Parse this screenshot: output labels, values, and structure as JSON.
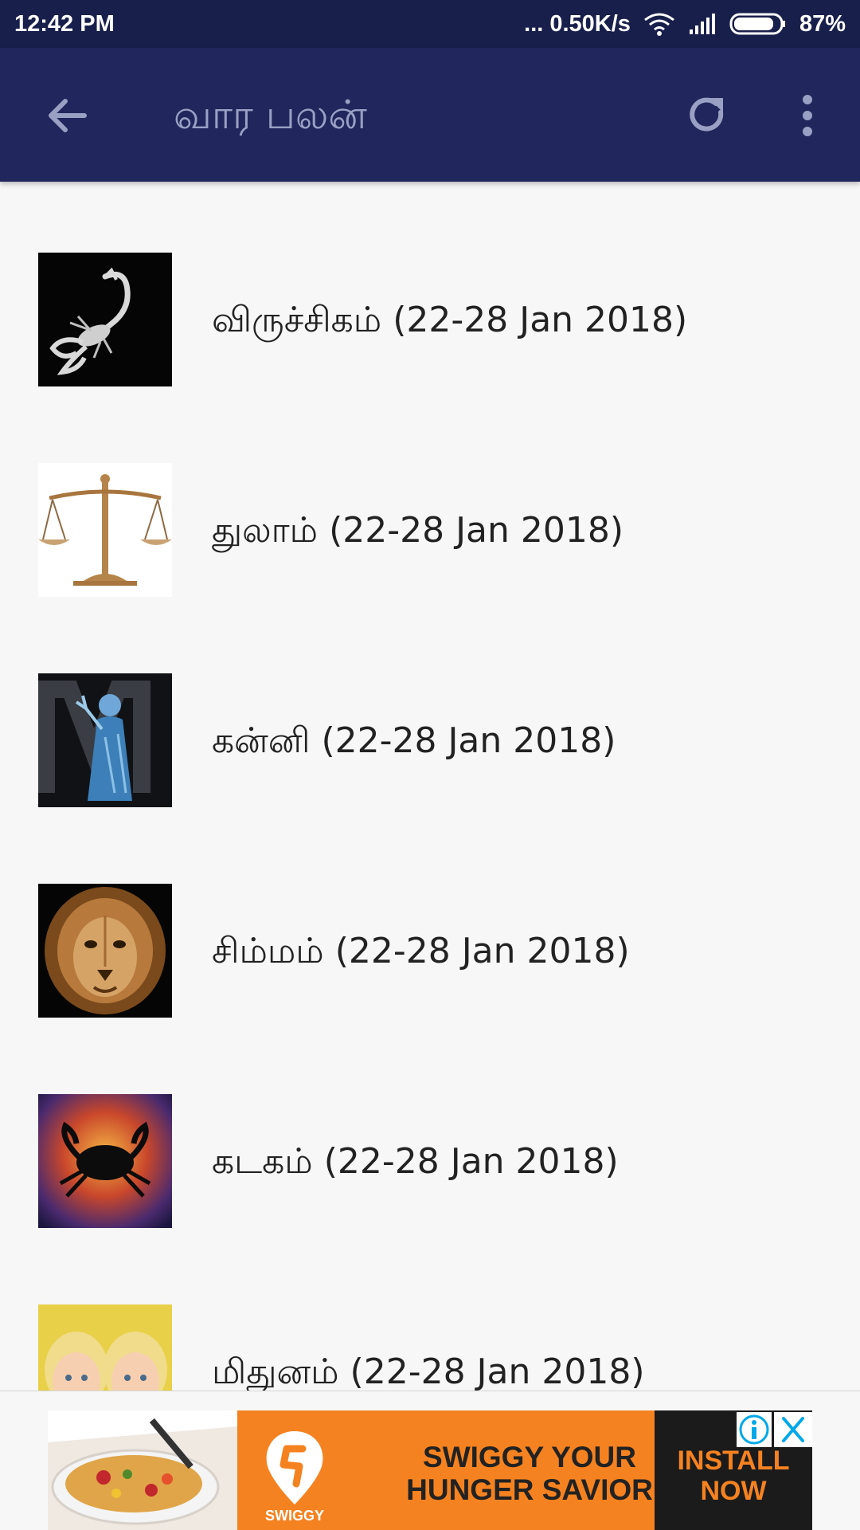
{
  "status_bar": {
    "time": "12:42 PM",
    "network_speed": "... 0.50K/s",
    "battery_percent": "87%",
    "battery_level": 0.87,
    "icons": [
      "wifi-icon",
      "signal-icon",
      "battery-icon"
    ]
  },
  "app_bar": {
    "title": "வார பலன்",
    "back_icon": "arrow-back-icon",
    "refresh_icon": "refresh-icon",
    "more_icon": "more-vert-icon",
    "background": "#21275c"
  },
  "list": {
    "items": [
      {
        "sign": "விருச்சிகம்",
        "range": "(22-28 Jan 2018)",
        "image": "scorpio-scorpion-image"
      },
      {
        "sign": "துலாம்",
        "range": "(22-28 Jan 2018)",
        "image": "libra-scales-image"
      },
      {
        "sign": "கன்னி",
        "range": "(22-28 Jan 2018)",
        "image": "virgo-maiden-image"
      },
      {
        "sign": "சிம்மம்",
        "range": "(22-28 Jan 2018)",
        "image": "leo-lion-image"
      },
      {
        "sign": "கடகம்",
        "range": "(22-28 Jan 2018)",
        "image": "cancer-crab-image"
      },
      {
        "sign": "மிதுனம்",
        "range": "(22-28 Jan 2018)",
        "image": "gemini-twins-image"
      }
    ]
  },
  "ad": {
    "brand": "SWIGGY",
    "headline": "SWIGGY YOUR\nHUNGER SAVIOR",
    "cta": "INSTALL\nNOW",
    "accent": "#f58220"
  }
}
